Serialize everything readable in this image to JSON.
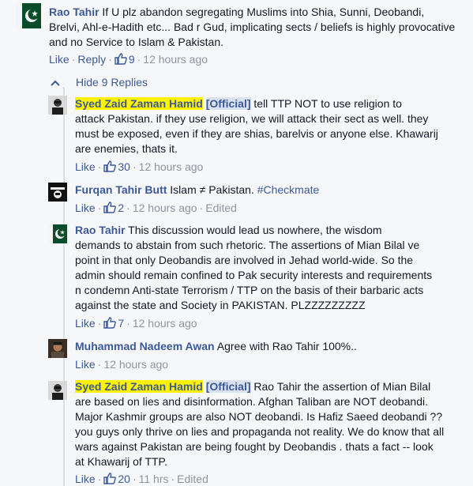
{
  "top_comment": {
    "author": "Rao Tahir",
    "text_line1": "If U plz abandon segregating Muslims into Shia, Sunni, Deobandi,",
    "text_line2": "Brelvi, Ahl-e-Hadith etc... Bad r Gud, implicating sects / beliefs is highly provocative",
    "text_line3": "and no Service to Islam & Pakistan.",
    "like": "Like",
    "reply": "Reply",
    "likes": "9",
    "time": "12 hours ago"
  },
  "hide_replies": "Hide 9 Replies",
  "replies": [
    {
      "author": "Syed Zaid Zaman Hamid",
      "badge": "[Official]",
      "lines": [
        " tell TTP NOT to use religion to",
        "attack Pakistan. if they use religion, we will attack their sect as well. they",
        "must be exposed, even if they are shias, barelvis or anyone else. Khawarij",
        "are enemies, thats it."
      ],
      "like": "Like",
      "likes": "30",
      "time": "12 hours ago"
    },
    {
      "author": "Furqan Tahir Butt",
      "text": " Islam ≠ Pakistan. ",
      "hashtag": "#Checkmate",
      "like": "Like",
      "likes": "2",
      "time": "12 hours ago",
      "edited": "Edited"
    },
    {
      "author": "Rao Tahir",
      "lines": [
        " This discussion would lead us nowhere, the wisdom",
        "demands to abstain from such rhetoric. The assertions of Mian Bilal ve",
        "point in that only Deobandis are involved in Jehad world-wide. So the",
        "admin should remain confined to Pak security interests and requirements",
        "n condemn Anti-state Terrorism / TTP on the basis of their barbaric acts",
        "against the state and Society in PAKISTAN. PLZZZZZZZZZ"
      ],
      "like": "Like",
      "likes": "7",
      "time": "12 hours ago"
    },
    {
      "author": "Muhammad Nadeem Awan",
      "text": " Agree with Rao Tahir 100%..",
      "like": "Like",
      "time": "12 hours ago"
    },
    {
      "author": "Syed Zaid Zaman Hamid",
      "badge": "[Official]",
      "lines": [
        " Rao Tahir the assertion of Mian Bilal",
        "are based on lies and disinformation. Afghan Taliban are NOT deobandi.",
        "Major Kashmir groups are also NOT deobandi. Is Hafiz Saeed deobandi ??",
        "you guys only thrive on lies and propaganda not reality. We do know that all",
        "wars against Pakistan are being fought by Deobandis . thats a fact -- look",
        "at Khawarij of TTP."
      ],
      "like": "Like",
      "likes": "20",
      "time": "11 hrs",
      "edited": "Edited"
    }
  ],
  "colors": {
    "link": "#3b5998",
    "meta": "#90949c",
    "highlight": "#fff200",
    "background": "#f6f7f9"
  }
}
